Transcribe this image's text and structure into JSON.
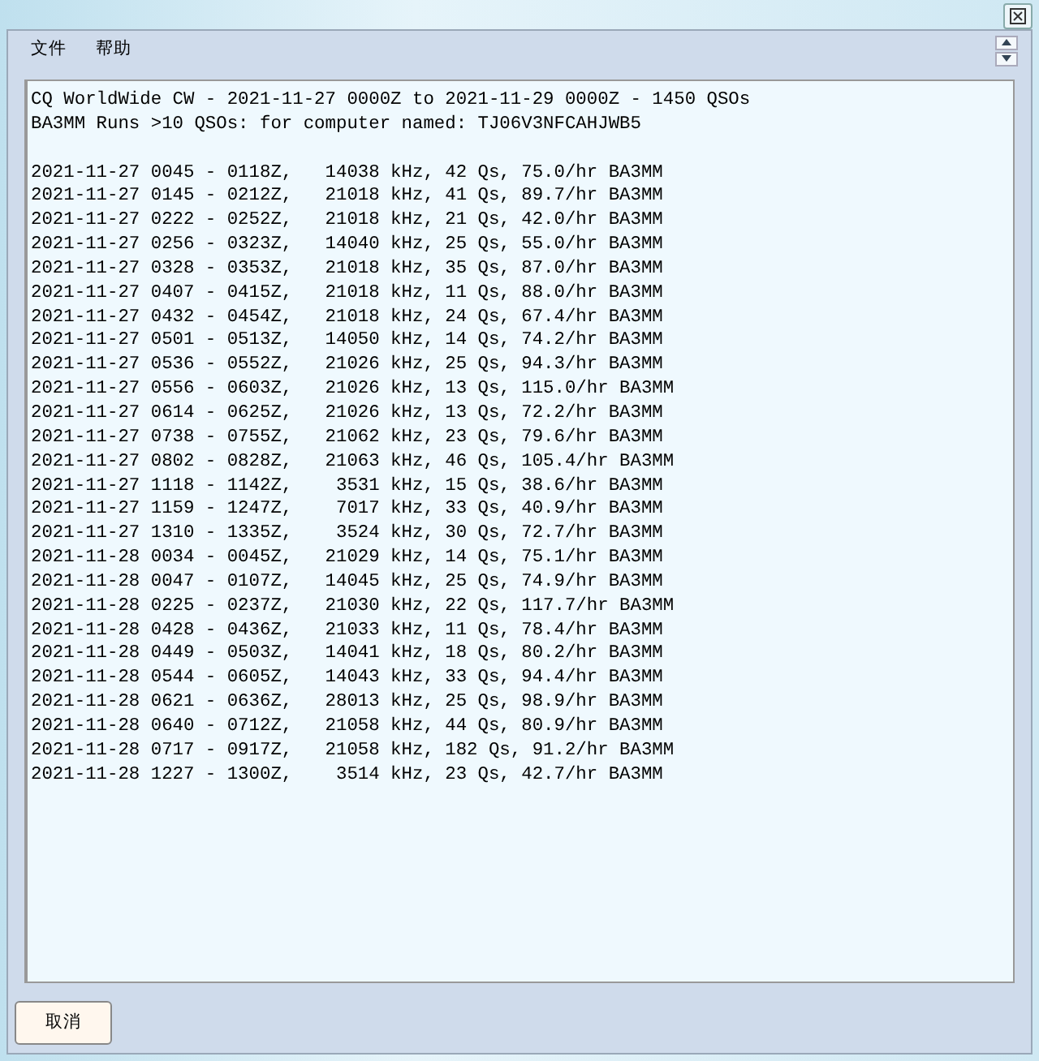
{
  "menu": [
    "文件",
    "帮助"
  ],
  "report": {
    "header": [
      "CQ WorldWide CW - 2021-11-27 0000Z to 2021-11-29 0000Z - 1450 QSOs",
      "BA3MM Runs >10 QSOs: for computer named: TJ06V3NFCAHJWB5"
    ],
    "lines": [
      "2021-11-27 0045 - 0118Z,   14038 kHz, 42 Qs, 75.0/hr BA3MM",
      "2021-11-27 0145 - 0212Z,   21018 kHz, 41 Qs, 89.7/hr BA3MM",
      "2021-11-27 0222 - 0252Z,   21018 kHz, 21 Qs, 42.0/hr BA3MM",
      "2021-11-27 0256 - 0323Z,   14040 kHz, 25 Qs, 55.0/hr BA3MM",
      "2021-11-27 0328 - 0353Z,   21018 kHz, 35 Qs, 87.0/hr BA3MM",
      "2021-11-27 0407 - 0415Z,   21018 kHz, 11 Qs, 88.0/hr BA3MM",
      "2021-11-27 0432 - 0454Z,   21018 kHz, 24 Qs, 67.4/hr BA3MM",
      "2021-11-27 0501 - 0513Z,   14050 kHz, 14 Qs, 74.2/hr BA3MM",
      "2021-11-27 0536 - 0552Z,   21026 kHz, 25 Qs, 94.3/hr BA3MM",
      "2021-11-27 0556 - 0603Z,   21026 kHz, 13 Qs, 115.0/hr BA3MM",
      "2021-11-27 0614 - 0625Z,   21026 kHz, 13 Qs, 72.2/hr BA3MM",
      "2021-11-27 0738 - 0755Z,   21062 kHz, 23 Qs, 79.6/hr BA3MM",
      "2021-11-27 0802 - 0828Z,   21063 kHz, 46 Qs, 105.4/hr BA3MM",
      "2021-11-27 1118 - 1142Z,    3531 kHz, 15 Qs, 38.6/hr BA3MM",
      "2021-11-27 1159 - 1247Z,    7017 kHz, 33 Qs, 40.9/hr BA3MM",
      "2021-11-27 1310 - 1335Z,    3524 kHz, 30 Qs, 72.7/hr BA3MM",
      "2021-11-28 0034 - 0045Z,   21029 kHz, 14 Qs, 75.1/hr BA3MM",
      "2021-11-28 0047 - 0107Z,   14045 kHz, 25 Qs, 74.9/hr BA3MM",
      "2021-11-28 0225 - 0237Z,   21030 kHz, 22 Qs, 117.7/hr BA3MM",
      "2021-11-28 0428 - 0436Z,   21033 kHz, 11 Qs, 78.4/hr BA3MM",
      "2021-11-28 0449 - 0503Z,   14041 kHz, 18 Qs, 80.2/hr BA3MM",
      "2021-11-28 0544 - 0605Z,   14043 kHz, 33 Qs, 94.4/hr BA3MM",
      "2021-11-28 0621 - 0636Z,   28013 kHz, 25 Qs, 98.9/hr BA3MM",
      "2021-11-28 0640 - 0712Z,   21058 kHz, 44 Qs, 80.9/hr BA3MM",
      "2021-11-28 0717 - 0917Z,   21058 kHz, 182 Qs, 91.2/hr BA3MM",
      "2021-11-28 1227 - 1300Z,    3514 kHz, 23 Qs, 42.7/hr BA3MM"
    ]
  },
  "buttons": [
    "取消"
  ]
}
